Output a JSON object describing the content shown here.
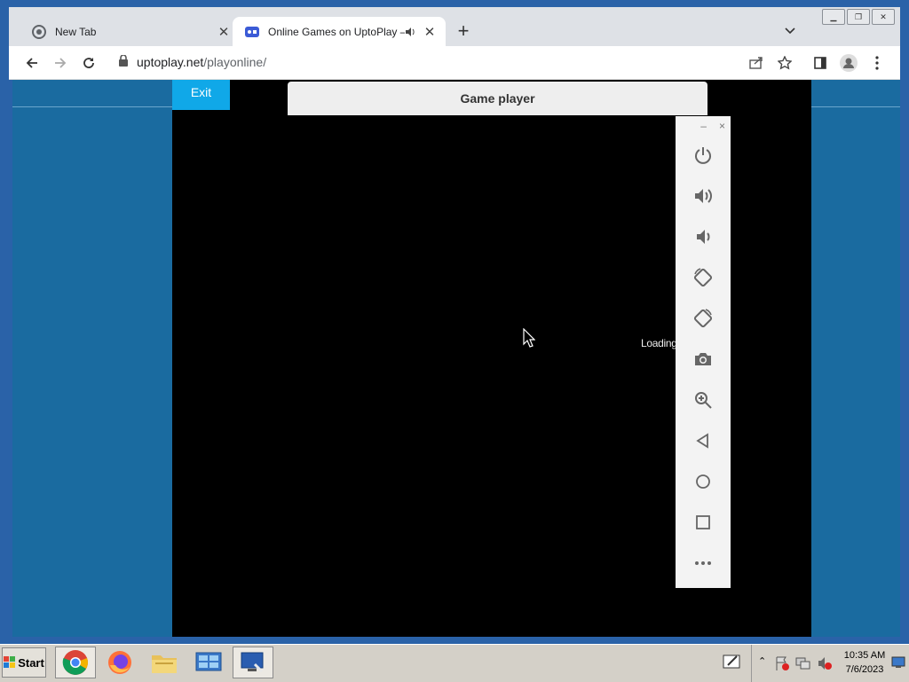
{
  "tabs": [
    {
      "title": "New Tab",
      "icon": "chrome-icon"
    },
    {
      "title": "Online Games on UptoPlay — P",
      "icon": "uptoplay-icon",
      "audio_icon": "speaker-icon"
    }
  ],
  "toolbar": {
    "url_domain": "uptoplay.net",
    "url_path": "/playonline/"
  },
  "page": {
    "exit_label": "Exit",
    "player_title": "Game player",
    "loading_text": "Loading",
    "side_panel": {
      "minimize": "–",
      "close": "×",
      "buttons": [
        "power-icon",
        "volume-up-icon",
        "volume-down-icon",
        "rotate-left-icon",
        "rotate-right-icon",
        "camera-icon",
        "zoom-icon",
        "back-icon",
        "home-icon",
        "recents-icon",
        "more-icon"
      ]
    }
  },
  "taskbar": {
    "start_label": "Start",
    "apps": [
      "chrome",
      "firefox",
      "file-explorer",
      "control-panel",
      "remote-desktop"
    ],
    "time": "10:35 AM",
    "date": "7/6/2023"
  }
}
